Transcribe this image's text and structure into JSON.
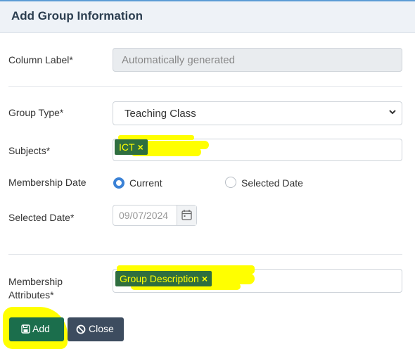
{
  "dialog": {
    "title": "Add Group Information"
  },
  "fields": {
    "column_label": {
      "label": "Column Label*",
      "placeholder": "Automatically generated"
    },
    "group_type": {
      "label": "Group Type*",
      "value": "Teaching Class"
    },
    "subjects": {
      "label": "Subjects*",
      "tags": [
        {
          "text": "ICT",
          "remove": "×"
        }
      ]
    },
    "membership_date": {
      "label": "Membership Date",
      "options": [
        {
          "label": "Current",
          "selected": true
        },
        {
          "label": "Selected Date",
          "selected": false
        }
      ]
    },
    "selected_date": {
      "label": "Selected Date*",
      "value": "09/07/2024"
    },
    "membership_attributes": {
      "label_line1": "Membership",
      "label_line2": "Attributes*",
      "tags": [
        {
          "text": "Group Description",
          "remove": "×"
        }
      ]
    }
  },
  "buttons": {
    "add": "Add",
    "close": "Close"
  },
  "colors": {
    "add_button": "#1b6e4c",
    "close_button": "#3d4c5f",
    "tag": "#2f6e3f",
    "highlight": "#ffff00",
    "accent": "#3b82d6"
  },
  "icons": {
    "add": "save-icon",
    "close": "ban-icon",
    "date": "calendar-icon",
    "select": "chevron-down-icon"
  }
}
